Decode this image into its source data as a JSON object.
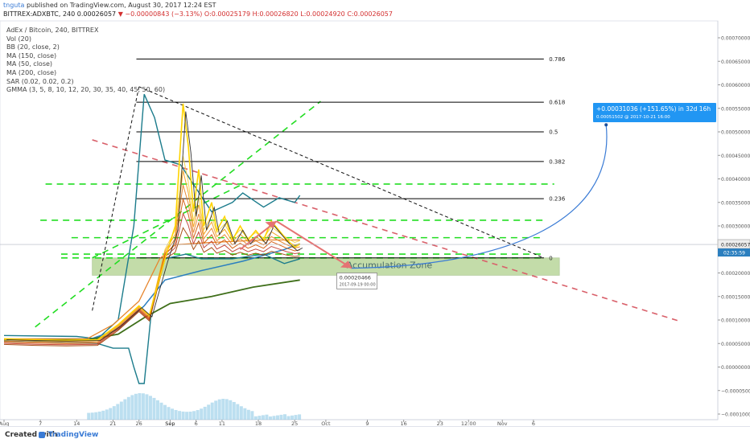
{
  "header": {
    "user": "tnguta",
    "published": " published on TradingView.com, August 30, 2017 12:24 EST",
    "symbol": "BITTREX:ADXBTC, 240",
    "last": "0.00026057",
    "change": "−0.00000843 (−3.13%)",
    "open": "O:0.00025179",
    "high": "H:0.00026820",
    "low": "L:0.00024920",
    "close": "C:0.00026057"
  },
  "legend": [
    "AdEx / Bitcoin, 240, BITTREX",
    "Vol (20)",
    "BB (20, close, 2)",
    "MA (150, close)",
    "MA (50, close)",
    "MA (200, close)",
    "SAR (0.02, 0.02, 0.2)",
    "GMMA (3, 5, 8, 10, 12, 20, 30, 35, 40, 45, 50, 60)"
  ],
  "footer": {
    "created": "Created with",
    "brand": "TradingView"
  },
  "colors": {
    "fib_line": "#000000",
    "support_green": "#22dd22",
    "downtrend_red": "#d9606a",
    "zone_fill": "#7cb342",
    "callout_blue": "#2196f3",
    "arrow_red": "#e57373"
  },
  "chart_data": {
    "type": "line",
    "y_axis_ticks": [
      "0.00070000",
      "0.00065000",
      "0.00060000",
      "0.00055000",
      "0.00050000",
      "0.00045000",
      "0.00040000",
      "0.00035000",
      "0.00030000",
      "0.00025000",
      "0.00020000",
      "0.00015000",
      "0.00010000",
      "0.00005000",
      "0.00000000",
      "−0.00005000",
      "−0.00010000"
    ],
    "ylim": [
      -0.0001,
      0.0007
    ],
    "x_axis_ticks": [
      "Aug",
      "7",
      "14",
      "21",
      "26",
      "Sep",
      "6",
      "11",
      "18",
      "25",
      "Oct",
      "9",
      "16",
      "23",
      "12:00",
      "Nov",
      "6"
    ],
    "price_label": "0.00026057",
    "countdown_label": "02:35:59",
    "fib_levels": [
      {
        "label": "0.786",
        "price": 0.000655
      },
      {
        "label": "0.618",
        "price": 0.000563
      },
      {
        "label": "0.5",
        "price": 0.0005
      },
      {
        "label": "0.382",
        "price": 0.000437
      },
      {
        "label": "0.236",
        "price": 0.000358
      },
      {
        "label": "0",
        "price": 0.000232
      }
    ],
    "support_levels": [
      0.000389,
      0.000312,
      0.000275,
      0.00024,
      0.000232
    ],
    "zone": {
      "label": "Accumulation Zone",
      "price_top": 0.000232,
      "price_bottom": 0.000195
    },
    "target_callout": {
      "line1": "+0.00031036 (+151.65%) in 32d 16h",
      "line2": "0.00051502 @ 2017-10-21 16:00"
    },
    "low_callout": {
      "line1": "0.00020466",
      "line2": "2017-09-19 00:00"
    },
    "close_series": [
      {
        "x": 0,
        "y": 6e-05
      },
      {
        "x": 6,
        "y": 5.8e-05
      },
      {
        "x": 12,
        "y": 5.7e-05
      },
      {
        "x": 18,
        "y": 5.8e-05
      },
      {
        "x": 22,
        "y": 9e-05
      },
      {
        "x": 26,
        "y": 0.00013
      },
      {
        "x": 28,
        "y": 0.00011
      },
      {
        "x": 31,
        "y": 0.00023
      },
      {
        "x": 33,
        "y": 0.0003
      },
      {
        "x": 34.5,
        "y": 0.00056
      },
      {
        "x": 35.5,
        "y": 0.00047
      },
      {
        "x": 36.5,
        "y": 0.00033
      },
      {
        "x": 37.5,
        "y": 0.00042
      },
      {
        "x": 38.5,
        "y": 0.0003
      },
      {
        "x": 40,
        "y": 0.00035
      },
      {
        "x": 41,
        "y": 0.00029
      },
      {
        "x": 42.5,
        "y": 0.00032
      },
      {
        "x": 44,
        "y": 0.00027
      },
      {
        "x": 45.5,
        "y": 0.0003
      },
      {
        "x": 47,
        "y": 0.00027
      },
      {
        "x": 48.5,
        "y": 0.00029
      },
      {
        "x": 50,
        "y": 0.00027
      },
      {
        "x": 51.5,
        "y": 0.00031
      },
      {
        "x": 53,
        "y": 0.00029
      },
      {
        "x": 54.5,
        "y": 0.00027
      },
      {
        "x": 56,
        "y": 0.000255
      },
      {
        "x": 57,
        "y": 0.000261
      }
    ]
  }
}
